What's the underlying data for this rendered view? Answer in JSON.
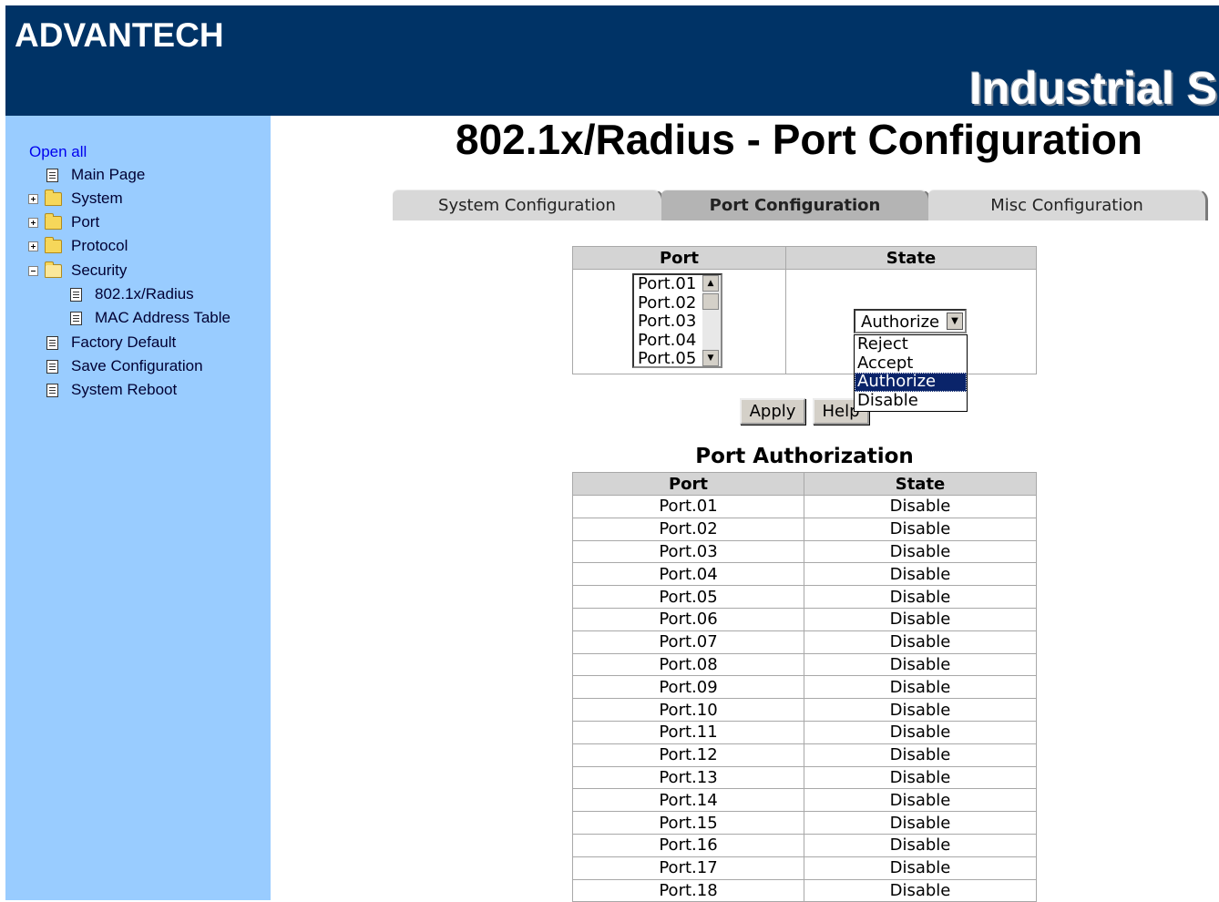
{
  "header": {
    "logo": "ADVANTECH",
    "banner": "Industrial S"
  },
  "sidebar": {
    "open_all": "Open all",
    "items": [
      {
        "label": "Main Page"
      },
      {
        "label": "System"
      },
      {
        "label": "Port"
      },
      {
        "label": "Protocol"
      },
      {
        "label": "Security"
      },
      {
        "label": "802.1x/Radius"
      },
      {
        "label": "MAC Address Table"
      },
      {
        "label": "Factory Default"
      },
      {
        "label": "Save Configuration"
      },
      {
        "label": "System Reboot"
      }
    ]
  },
  "page": {
    "title": "802.1x/Radius - Port Configuration"
  },
  "tabs": [
    {
      "label": "System Configuration"
    },
    {
      "label": "Port Configuration"
    },
    {
      "label": "Misc Configuration"
    }
  ],
  "config": {
    "port_header": "Port",
    "state_header": "State",
    "port_options": [
      "Port.01",
      "Port.02",
      "Port.03",
      "Port.04",
      "Port.05"
    ],
    "state_selected": "Authorize",
    "state_options": [
      "Reject",
      "Accept",
      "Authorize",
      "Disable"
    ],
    "apply_label": "Apply",
    "help_label": "Help"
  },
  "auth": {
    "title": "Port Authorization",
    "port_header": "Port",
    "state_header": "State",
    "rows": [
      {
        "port": "Port.01",
        "state": "Disable"
      },
      {
        "port": "Port.02",
        "state": "Disable"
      },
      {
        "port": "Port.03",
        "state": "Disable"
      },
      {
        "port": "Port.04",
        "state": "Disable"
      },
      {
        "port": "Port.05",
        "state": "Disable"
      },
      {
        "port": "Port.06",
        "state": "Disable"
      },
      {
        "port": "Port.07",
        "state": "Disable"
      },
      {
        "port": "Port.08",
        "state": "Disable"
      },
      {
        "port": "Port.09",
        "state": "Disable"
      },
      {
        "port": "Port.10",
        "state": "Disable"
      },
      {
        "port": "Port.11",
        "state": "Disable"
      },
      {
        "port": "Port.12",
        "state": "Disable"
      },
      {
        "port": "Port.13",
        "state": "Disable"
      },
      {
        "port": "Port.14",
        "state": "Disable"
      },
      {
        "port": "Port.15",
        "state": "Disable"
      },
      {
        "port": "Port.16",
        "state": "Disable"
      },
      {
        "port": "Port.17",
        "state": "Disable"
      },
      {
        "port": "Port.18",
        "state": "Disable"
      }
    ]
  },
  "colors": {
    "header_bg": "#003366",
    "sidebar_bg": "#99ccff",
    "selection": "#0a246a"
  }
}
